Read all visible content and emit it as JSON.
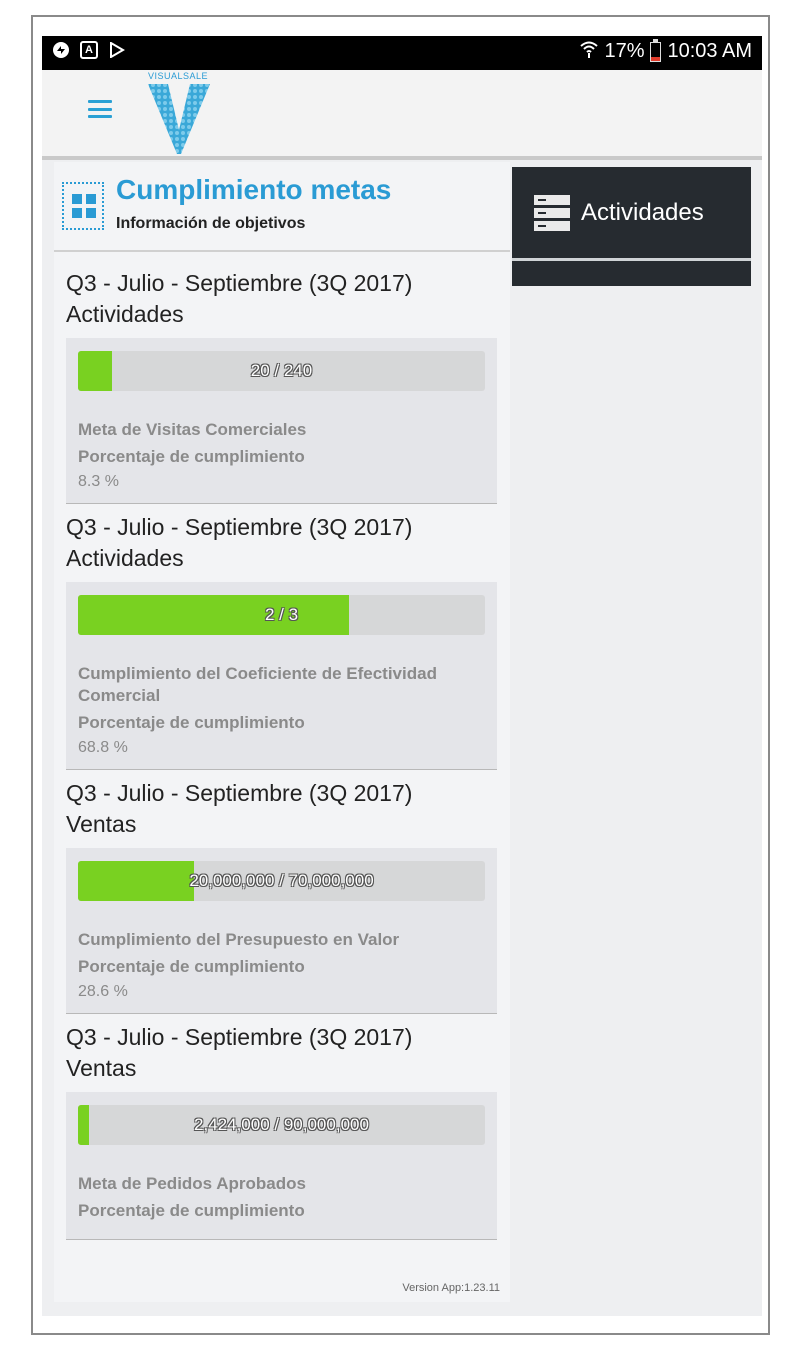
{
  "status_bar": {
    "left_icons": [
      "sync-icon",
      "font-a-icon",
      "play-store-icon"
    ],
    "battery": "17%",
    "time": "10:03 AM"
  },
  "app_bar": {
    "logo_text": "VISUALSALE"
  },
  "header": {
    "title": "Cumplimiento metas",
    "subtitle": "Información de objetivos"
  },
  "goals": [
    {
      "period": "Q3 - Julio - Septiembre (3Q 2017)",
      "category": "Actividades",
      "progress_text": "20 / 240",
      "progress_fraction": 0.083,
      "name": "Meta de Visitas Comerciales",
      "pct_label": "Porcentaje de cumplimiento",
      "pct_value": "8.3 %"
    },
    {
      "period": "Q3 - Julio - Septiembre (3Q 2017)",
      "category": "Actividades",
      "progress_text": "2 / 3",
      "progress_fraction": 0.667,
      "name": "Cumplimiento del Coeficiente de Efectividad Comercial",
      "pct_label": "Porcentaje de cumplimiento",
      "pct_value": "68.8 %"
    },
    {
      "period": "Q3 - Julio - Septiembre (3Q 2017)",
      "category": "Ventas",
      "progress_text": "20,000,000 / 70,000,000",
      "progress_fraction": 0.286,
      "name": "Cumplimiento del Presupuesto en Valor",
      "pct_label": "Porcentaje de cumplimiento",
      "pct_value": "28.6 %"
    },
    {
      "period": "Q3 - Julio - Septiembre (3Q 2017)",
      "category": "Ventas",
      "progress_text": "2,424,000 / 90,000,000",
      "progress_fraction": 0.027,
      "name": "Meta de Pedidos Aprobados",
      "pct_label": "Porcentaje de cumplimiento",
      "pct_value": ""
    }
  ],
  "version": "Version App:1.23.11",
  "side_menu": {
    "item_label": "Actividades"
  },
  "colors": {
    "accent": "#2a9bd4",
    "progress_fill": "#79d121",
    "side_menu_bg": "#262b30"
  }
}
